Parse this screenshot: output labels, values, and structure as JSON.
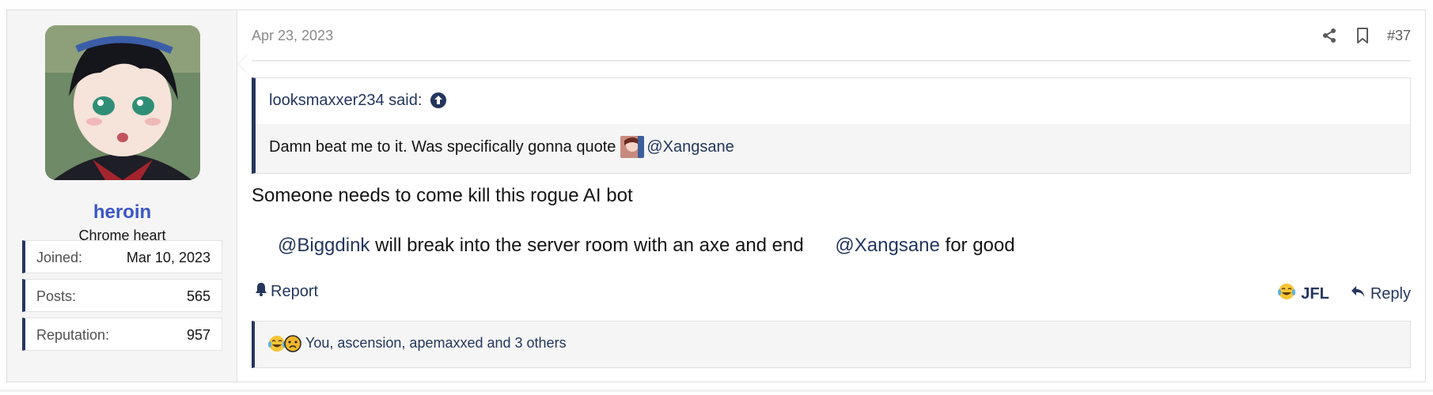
{
  "user": {
    "name": "heroin",
    "title": "Chrome heart",
    "stats": [
      {
        "label": "Joined:",
        "value": "Mar 10, 2023"
      },
      {
        "label": "Posts:",
        "value": "565"
      },
      {
        "label": "Reputation:",
        "value": "957"
      }
    ]
  },
  "post": {
    "date": "Apr 23, 2023",
    "number": "#37",
    "quote": {
      "author": "looksmaxxer234 said:",
      "text_before": "Damn beat me to it. Was specifically gonna quote",
      "mention": "@Xangsane"
    },
    "message_line1": "Someone needs to come kill this rogue AI bot",
    "message_line2": {
      "mention1": "@Biggdink",
      "middle": " will break into the server room with an axe and end ",
      "mention2": "@Xangsane",
      "end": " for good"
    }
  },
  "actions": {
    "report": "Report",
    "jfl": "JFL",
    "reply": "Reply"
  },
  "reactions": {
    "text": "You, ascension, apemaxxed and 3 others"
  },
  "icons": {
    "share": "share-icon",
    "bookmark": "bookmark-icon",
    "quote_up": "arrow-up-circle-icon",
    "report": "bell-icon",
    "reply": "reply-arrow-icon",
    "jfl": "crying-laughing-emoji-icon"
  },
  "colors": {
    "link": "#24365d",
    "username": "#3a56c6",
    "accent_bar": "#24365d"
  }
}
